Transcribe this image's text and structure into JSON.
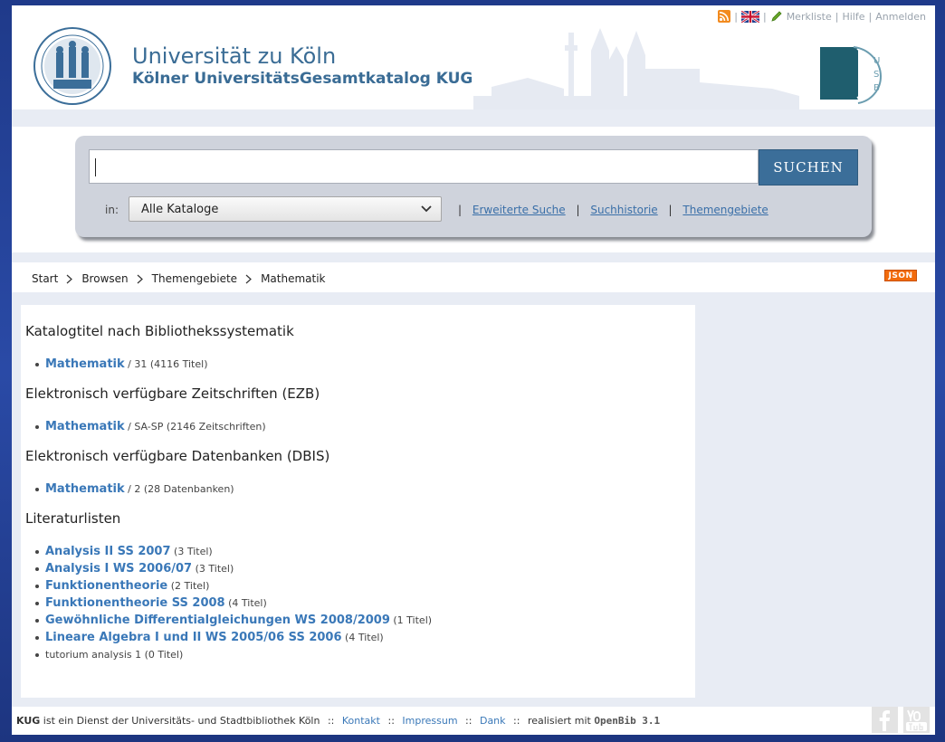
{
  "header": {
    "university": "Universität zu Köln",
    "catalog": "Kölner UniversitätsGesamtkatalog KUG",
    "toplinks": {
      "merkliste": "Merkliste",
      "hilfe": "Hilfe",
      "anmelden": "Anmelden",
      "separator": "|"
    }
  },
  "search": {
    "query": "",
    "button_label": "SUCHEN",
    "in_label": "in:",
    "catalog_selected": "Alle Kataloge",
    "links": [
      "Erweiterte Suche",
      "Suchhistorie",
      "Themengebiete"
    ],
    "separator": "|"
  },
  "breadcrumb": [
    "Start",
    "Browsen",
    "Themengebiete",
    "Mathematik"
  ],
  "json_badge": "JSON",
  "sections": [
    {
      "title": "Katalogtitel nach Bibliothekssystematik",
      "items": [
        {
          "link": "Mathematik",
          "note": " / 31 (4116 Titel)"
        }
      ]
    },
    {
      "title": "Elektronisch verfügbare Zeitschriften (EZB)",
      "items": [
        {
          "link": "Mathematik",
          "note": " / SA-SP (2146 Zeitschriften)"
        }
      ]
    },
    {
      "title": "Elektronisch verfügbare Datenbanken (DBIS)",
      "items": [
        {
          "link": "Mathematik",
          "note": " / 2 (28 Datenbanken)"
        }
      ]
    },
    {
      "title": "Literaturlisten",
      "items": [
        {
          "link": "Analysis II SS 2007",
          "note": " (3 Titel)"
        },
        {
          "link": "Analysis I WS 2006/07",
          "note": " (3 Titel)"
        },
        {
          "link": "Funktionentheorie",
          "note": " (2 Titel)"
        },
        {
          "link": "Funktionentheorie SS 2008",
          "note": " (4 Titel)"
        },
        {
          "link": "Gewöhnliche Differentialgleichungen WS 2008/2009",
          "note": " (1 Titel)"
        },
        {
          "link": "Lineare Algebra I und II WS 2005/06 SS 2006",
          "note": " (4 Titel)"
        },
        {
          "link": "",
          "note": "tutorium analysis 1 (0 Titel)"
        }
      ]
    }
  ],
  "footer": {
    "brand": "KUG",
    "text": " ist ein Dienst der Universitäts- und Stadtbibliothek Köln",
    "sep": "::",
    "kontakt": "Kontakt",
    "impressum": "Impressum",
    "dank": "Dank",
    "realisiert": "realisiert mit",
    "openbib": "OpenBib 3.1"
  },
  "colors": {
    "accent": "#3b6e99",
    "link": "#3a78b8",
    "json": "#f26b0c"
  }
}
